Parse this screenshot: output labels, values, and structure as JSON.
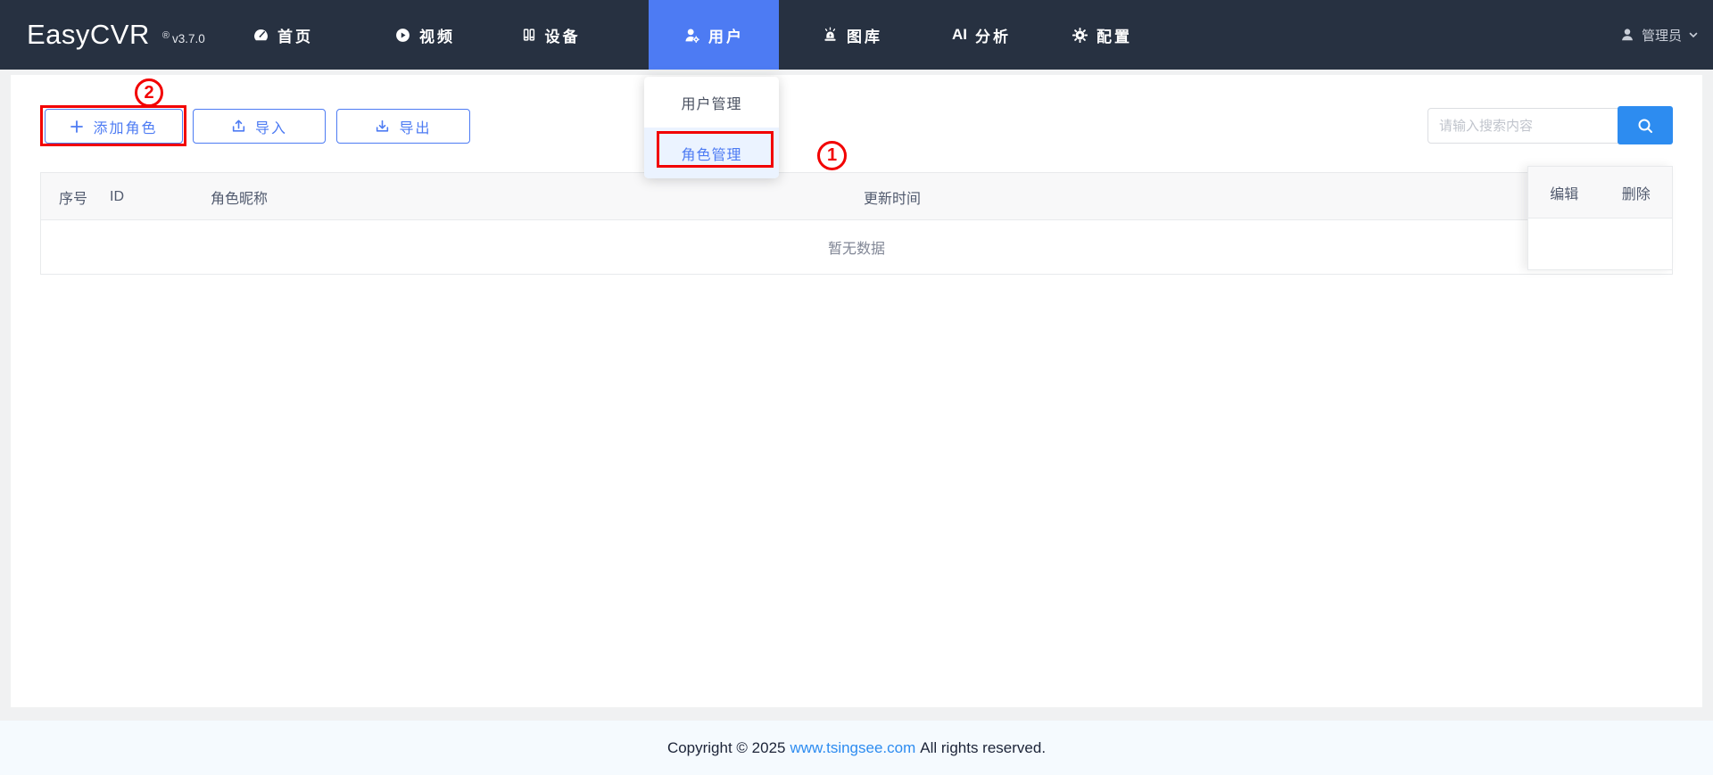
{
  "brand": {
    "name": "EasyCVR",
    "registered": "®",
    "version": "v3.7.0"
  },
  "nav": {
    "items": [
      {
        "label": "首页",
        "icon": "dashboard-icon",
        "active": false
      },
      {
        "label": "视频",
        "icon": "play-icon",
        "active": false
      },
      {
        "label": "设备",
        "icon": "device-icon",
        "active": false
      },
      {
        "label": "用户",
        "icon": "user-gear-icon",
        "active": true
      },
      {
        "label": "图库",
        "icon": "siren-icon",
        "active": false
      },
      {
        "label": "分析",
        "icon_text": "AI",
        "active": false
      },
      {
        "label": "配置",
        "icon": "gear-icon",
        "active": false
      }
    ]
  },
  "account": {
    "label": "管理员"
  },
  "user_dropdown": {
    "items": [
      {
        "label": "用户管理",
        "active": false
      },
      {
        "label": "角色管理",
        "active": true
      }
    ]
  },
  "annotations": {
    "step1": "1",
    "step2": "2",
    "color": "#F20000"
  },
  "toolbar": {
    "add_role_label": "添加角色",
    "import_label": "导入",
    "export_label": "导出"
  },
  "search": {
    "placeholder": "请输入搜索内容"
  },
  "table": {
    "headers": [
      "序号",
      "ID",
      "角色昵称",
      "更新时间"
    ],
    "action_headers": [
      "编辑",
      "删除"
    ],
    "empty_text": "暂无数据",
    "rows": []
  },
  "footer": {
    "copyright_prefix": "Copyright © 2025",
    "link_text": "www.tsingsee.com",
    "copyright_suffix": "All rights reserved."
  },
  "colors": {
    "navbar_bg": "#273141",
    "active_nav_bg": "#4D7BF3",
    "primary_blue": "#4D7BF3",
    "search_button_blue": "#2D8CF0",
    "annotation_red": "#F20000",
    "link_blue": "#2D8CF0",
    "table_header_bg": "#F8F8F9",
    "footer_bg": "#F5FAFE"
  }
}
